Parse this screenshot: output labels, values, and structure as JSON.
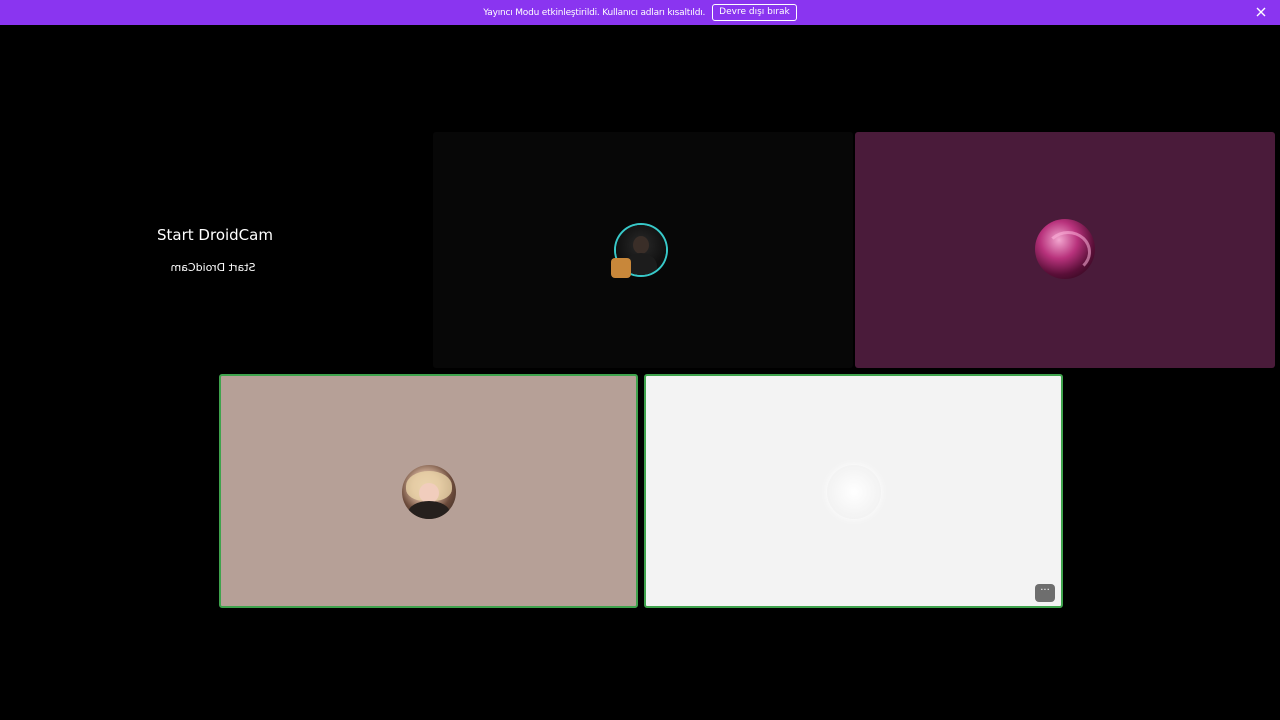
{
  "banner": {
    "message": "Yayıncı Modu etkinleştirildi. Kullanıcı adları kısaltıldı.",
    "disable_label": "Devre dışı bırak",
    "close_icon": "close-icon",
    "background_color": "#8a35f0"
  },
  "droidcam": {
    "title": "Start DroidCam",
    "mirrored_text": "Start DroidCam"
  },
  "tiles": {
    "user1": {
      "muted_icon": "microphone-muted-icon",
      "ring_color": "#38c9c9"
    },
    "user2": {
      "background_color": "#4a1b3a"
    },
    "user3": {
      "background_color": "#b6a097",
      "speaking_border_color": "#3fa34d"
    },
    "user4": {
      "background_color": "#f3f3f3",
      "more_label": "···",
      "speaking_border_color": "#3fa34d"
    }
  }
}
